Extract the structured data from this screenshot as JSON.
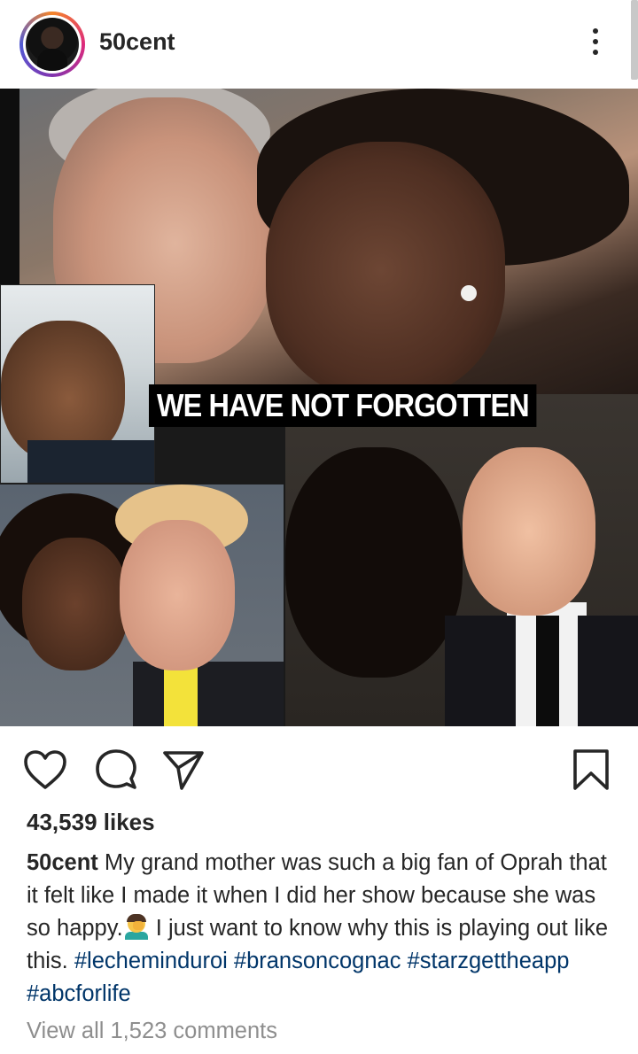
{
  "header": {
    "username": "50cent",
    "more_icon": "more-vertical-icon"
  },
  "post": {
    "image_overlay_text": "WE HAVE NOT FORGOTTEN"
  },
  "actions": {
    "like_icon": "heart-icon",
    "comment_icon": "comment-icon",
    "share_icon": "send-icon",
    "save_icon": "bookmark-icon"
  },
  "likes": "43,539 likes",
  "caption": {
    "username": "50cent",
    "text_1": " My grand mother was such a big fan of Oprah that it felt like I made it when I did her show because she was so happy.",
    "emoji": "man-facepalming-emoji",
    "text_2": " I just want to know why this is playing out like this. ",
    "hashtags": [
      "#lecheminduroi",
      "#bransoncognac",
      "#starzgettheapp",
      "#abcforlife"
    ]
  },
  "view_comments": "View all 1,523 comments",
  "colors": {
    "text": "#262626",
    "hashtag": "#003569",
    "muted": "#8e8e8e"
  }
}
